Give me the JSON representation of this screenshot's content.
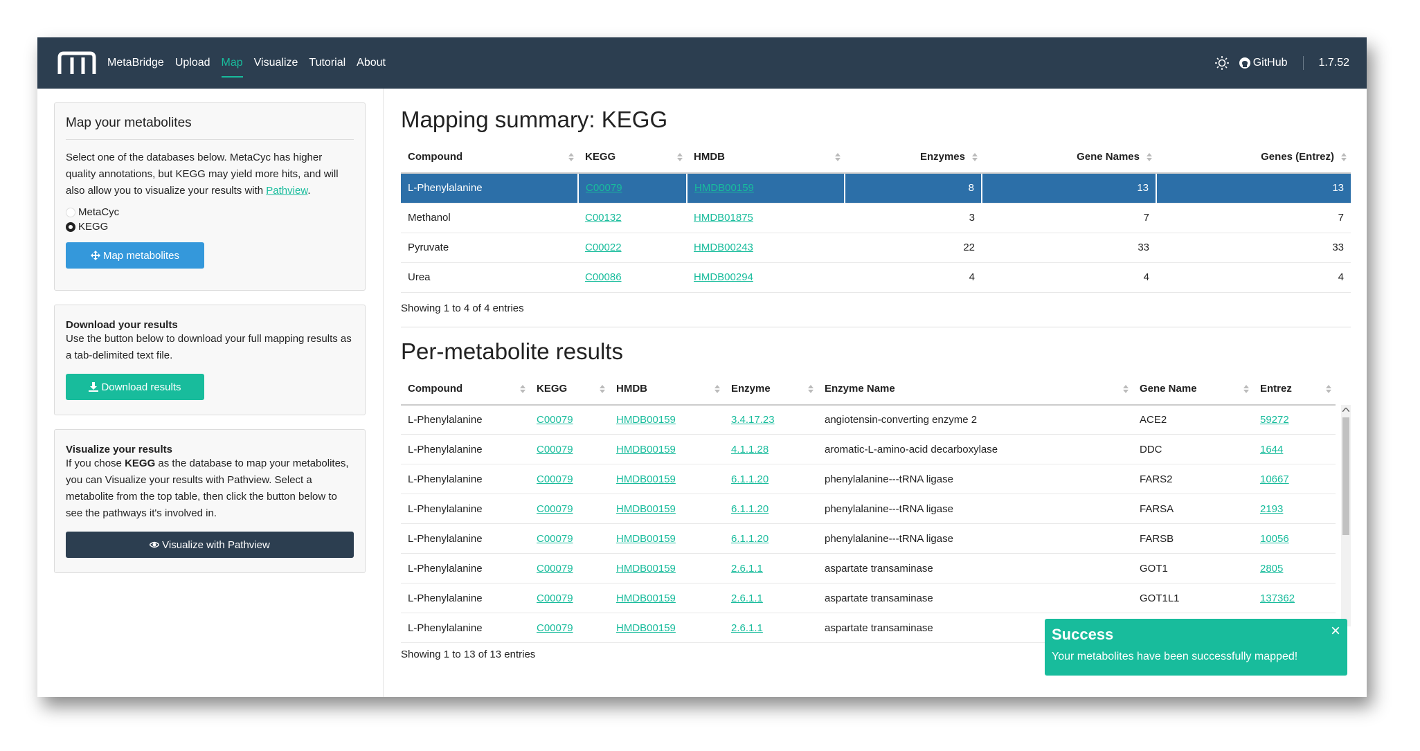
{
  "navbar": {
    "brand": "MetaBridge",
    "links": [
      "Upload",
      "Map",
      "Visualize",
      "Tutorial",
      "About"
    ],
    "active": "Map",
    "github": "GitHub",
    "version": "1.7.52"
  },
  "sidebar": {
    "map_panel": {
      "title": "Map your metabolites",
      "desc_pre": "Select one of the databases below. MetaCyc has higher quality annotations, but KEGG may yield more hits, and will also allow you to visualize your results with ",
      "desc_link": "Pathview",
      "desc_post": ".",
      "options": [
        "MetaCyc",
        "KEGG"
      ],
      "selected": "KEGG",
      "button": "Map metabolites"
    },
    "download_panel": {
      "title": "Download your results",
      "desc": "Use the button below to download your full mapping results as a tab-delimited text file.",
      "button": "Download results"
    },
    "visualize_panel": {
      "title": "Visualize your results",
      "desc_pre": "If you chose ",
      "desc_bold": "KEGG",
      "desc_post": " as the database to map your metabolites, you can Visualize your results with Pathview. Select a metabolite from the top table, then click the button below to see the pathways it's involved in.",
      "button": "Visualize with Pathview"
    }
  },
  "summary": {
    "title": "Mapping summary: KEGG",
    "headers": [
      "Compound",
      "KEGG",
      "HMDB",
      "Enzymes",
      "Gene Names",
      "Genes (Entrez)"
    ],
    "rows": [
      [
        "L-Phenylalanine",
        "C00079",
        "HMDB00159",
        "8",
        "13",
        "13"
      ],
      [
        "Methanol",
        "C00132",
        "HMDB01875",
        "3",
        "7",
        "7"
      ],
      [
        "Pyruvate",
        "C00022",
        "HMDB00243",
        "22",
        "33",
        "33"
      ],
      [
        "Urea",
        "C00086",
        "HMDB00294",
        "4",
        "4",
        "4"
      ]
    ],
    "info": "Showing 1 to 4 of 4 entries"
  },
  "per_metabolite": {
    "title": "Per-metabolite results",
    "headers": [
      "Compound",
      "KEGG",
      "HMDB",
      "Enzyme",
      "Enzyme Name",
      "Gene Name",
      "Entrez"
    ],
    "rows": [
      [
        "L-Phenylalanine",
        "C00079",
        "HMDB00159",
        "3.4.17.23",
        "angiotensin-converting enzyme 2",
        "ACE2",
        "59272"
      ],
      [
        "L-Phenylalanine",
        "C00079",
        "HMDB00159",
        "4.1.1.28",
        "aromatic-L-amino-acid decarboxylase",
        "DDC",
        "1644"
      ],
      [
        "L-Phenylalanine",
        "C00079",
        "HMDB00159",
        "6.1.1.20",
        "phenylalanine---tRNA ligase",
        "FARS2",
        "10667"
      ],
      [
        "L-Phenylalanine",
        "C00079",
        "HMDB00159",
        "6.1.1.20",
        "phenylalanine---tRNA ligase",
        "FARSA",
        "2193"
      ],
      [
        "L-Phenylalanine",
        "C00079",
        "HMDB00159",
        "6.1.1.20",
        "phenylalanine---tRNA ligase",
        "FARSB",
        "10056"
      ],
      [
        "L-Phenylalanine",
        "C00079",
        "HMDB00159",
        "2.6.1.1",
        "aspartate transaminase",
        "GOT1",
        "2805"
      ],
      [
        "L-Phenylalanine",
        "C00079",
        "HMDB00159",
        "2.6.1.1",
        "aspartate transaminase",
        "GOT1L1",
        "137362"
      ],
      [
        "L-Phenylalanine",
        "C00079",
        "HMDB00159",
        "2.6.1.1",
        "aspartate transaminase",
        "",
        ""
      ]
    ],
    "info": "Showing 1 to 13 of 13 entries"
  },
  "toast": {
    "title": "Success",
    "message": "Your metabolites have been successfully mapped!",
    "close": "×"
  },
  "colors": {
    "navbar": "#2c3e50",
    "accent": "#18bc9c",
    "primary": "#3498db",
    "selected_row": "#2c6fa8",
    "dark_button": "#2c3e50"
  }
}
